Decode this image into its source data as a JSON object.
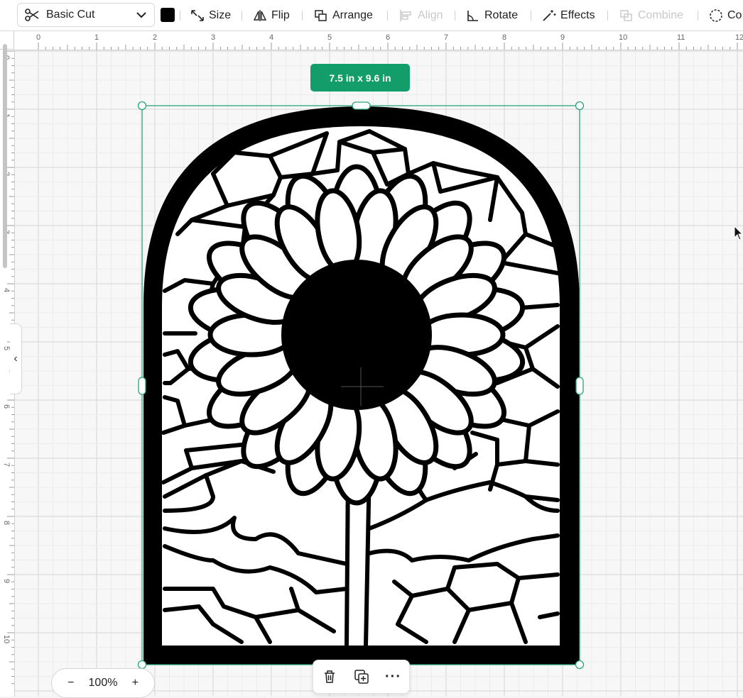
{
  "toolbar": {
    "operation_label": "Basic Cut",
    "swatch_color": "#000000",
    "size_label": "Size",
    "flip_label": "Flip",
    "arrange_label": "Arrange",
    "align_label": "Align",
    "rotate_label": "Rotate",
    "effects_label": "Effects",
    "combine_label": "Combine",
    "contour_label": "Co"
  },
  "ruler": {
    "top_labels": [
      "0",
      "1",
      "2",
      "3",
      "4",
      "5",
      "6",
      "7",
      "8",
      "9",
      "10",
      "11",
      "12"
    ],
    "left_labels": [
      "0",
      "1",
      "2",
      "3",
      "4",
      "5",
      "6",
      "7",
      "8",
      "9",
      "10"
    ]
  },
  "selection": {
    "size_badge": "7.5  in x 9.6  in",
    "accent_color": "#129d6a"
  },
  "zoom": {
    "minus": "−",
    "value": "100%",
    "plus": "+"
  },
  "selection_toolbar": {
    "more": "···"
  },
  "collapse_tab": {
    "icon": "‹"
  }
}
